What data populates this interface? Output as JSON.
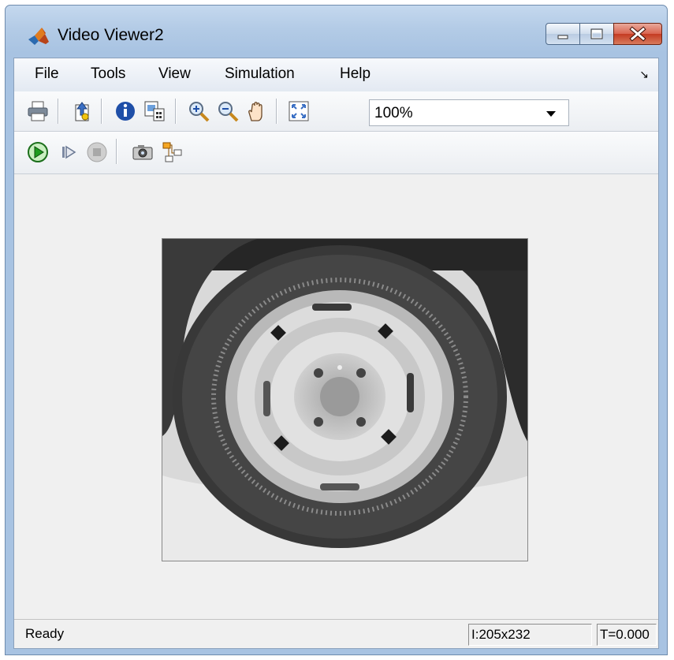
{
  "window": {
    "title": "Video Viewer2"
  },
  "menu": {
    "items": [
      "File",
      "Tools",
      "View",
      "Simulation",
      "Help"
    ]
  },
  "toolbar": {
    "tools": [
      "print-icon",
      "open-icon",
      "info-icon",
      "export-icon",
      "zoom-in-icon",
      "zoom-out-icon",
      "pan-hand-icon",
      "fit-to-view-icon"
    ],
    "zoom_value": "100%"
  },
  "playback": {
    "tools": [
      "play-icon",
      "step-forward-icon",
      "stop-icon",
      "snapshot-icon",
      "highlight-block-icon"
    ]
  },
  "status": {
    "text": "Ready",
    "image_size": "I:205x232",
    "time": "T=0.000"
  },
  "colors": {
    "play": "#1f9b1f",
    "title_bar": "#b3cbe6",
    "close": "#c43b22"
  }
}
